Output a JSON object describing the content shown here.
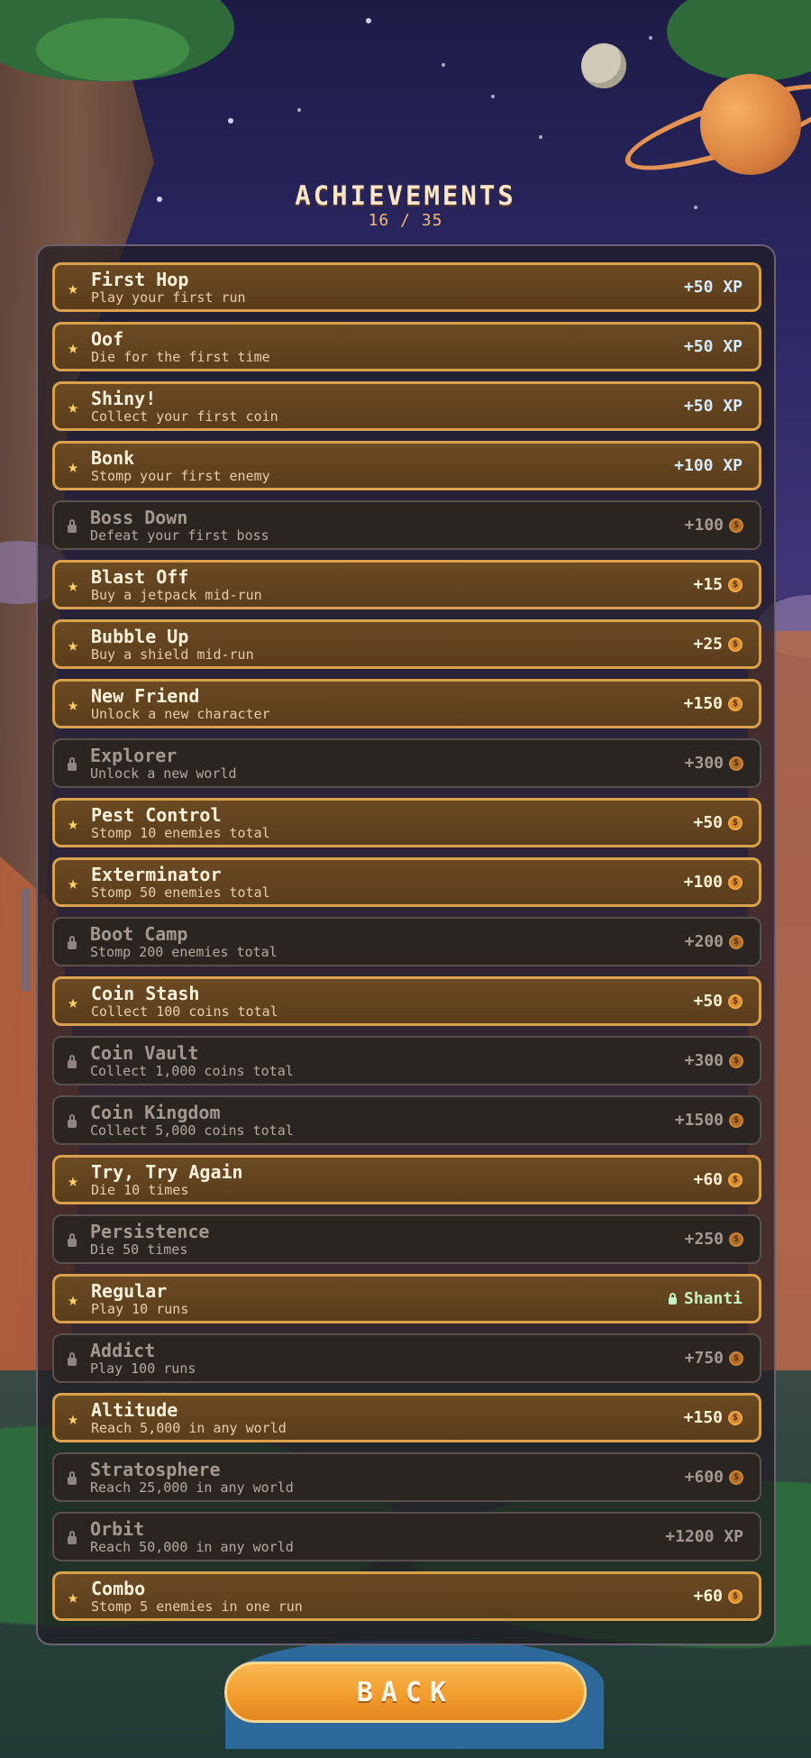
{
  "header": {
    "title": "ACHIEVEMENTS",
    "progress": "16 / 35"
  },
  "achievements": [
    {
      "name": "First Hop",
      "desc": "Play your first run",
      "reward": "+50 XP",
      "reward_type": "xp",
      "unlocked": true
    },
    {
      "name": "Oof",
      "desc": "Die for the first time",
      "reward": "+50 XP",
      "reward_type": "xp",
      "unlocked": true
    },
    {
      "name": "Shiny!",
      "desc": "Collect your first coin",
      "reward": "+50 XP",
      "reward_type": "xp",
      "unlocked": true
    },
    {
      "name": "Bonk",
      "desc": "Stomp your first enemy",
      "reward": "+100 XP",
      "reward_type": "xp",
      "unlocked": true
    },
    {
      "name": "Boss Down",
      "desc": "Defeat your first boss",
      "reward": "+100",
      "reward_type": "coin",
      "unlocked": false
    },
    {
      "name": "Blast Off",
      "desc": "Buy a jetpack mid-run",
      "reward": "+15",
      "reward_type": "coin",
      "unlocked": true
    },
    {
      "name": "Bubble Up",
      "desc": "Buy a shield mid-run",
      "reward": "+25",
      "reward_type": "coin",
      "unlocked": true
    },
    {
      "name": "New Friend",
      "desc": "Unlock a new character",
      "reward": "+150",
      "reward_type": "coin",
      "unlocked": true
    },
    {
      "name": "Explorer",
      "desc": "Unlock a new world",
      "reward": "+300",
      "reward_type": "coin",
      "unlocked": false
    },
    {
      "name": "Pest Control",
      "desc": "Stomp 10 enemies total",
      "reward": "+50",
      "reward_type": "coin",
      "unlocked": true
    },
    {
      "name": "Exterminator",
      "desc": "Stomp 50 enemies total",
      "reward": "+100",
      "reward_type": "coin",
      "unlocked": true
    },
    {
      "name": "Boot Camp",
      "desc": "Stomp 200 enemies total",
      "reward": "+200",
      "reward_type": "coin",
      "unlocked": false
    },
    {
      "name": "Coin Stash",
      "desc": "Collect 100 coins total",
      "reward": "+50",
      "reward_type": "coin",
      "unlocked": true
    },
    {
      "name": "Coin Vault",
      "desc": "Collect 1,000 coins total",
      "reward": "+300",
      "reward_type": "coin",
      "unlocked": false
    },
    {
      "name": "Coin Kingdom",
      "desc": "Collect 5,000 coins total",
      "reward": "+1500",
      "reward_type": "coin",
      "unlocked": false
    },
    {
      "name": "Try, Try Again",
      "desc": "Die 10 times",
      "reward": "+60",
      "reward_type": "coin",
      "unlocked": true
    },
    {
      "name": "Persistence",
      "desc": "Die 50 times",
      "reward": "+250",
      "reward_type": "coin",
      "unlocked": false
    },
    {
      "name": "Regular",
      "desc": "Play 10 runs",
      "reward": "Shanti",
      "reward_type": "character",
      "unlocked": true
    },
    {
      "name": "Addict",
      "desc": "Play 100 runs",
      "reward": "+750",
      "reward_type": "coin",
      "unlocked": false
    },
    {
      "name": "Altitude",
      "desc": "Reach 5,000 in any world",
      "reward": "+150",
      "reward_type": "coin",
      "unlocked": true
    },
    {
      "name": "Stratosphere",
      "desc": "Reach 25,000 in any world",
      "reward": "+600",
      "reward_type": "coin",
      "unlocked": false
    },
    {
      "name": "Orbit",
      "desc": "Reach 50,000 in any world",
      "reward": "+1200 XP",
      "reward_type": "xp",
      "unlocked": false
    },
    {
      "name": "Combo",
      "desc": "Stomp 5 enemies in one run",
      "reward": "+60",
      "reward_type": "coin",
      "unlocked": true
    }
  ],
  "icons": {
    "unlocked": "star-icon",
    "locked": "lock-icon",
    "coin": "coin-icon"
  },
  "colors": {
    "accent": "#f29a2c",
    "unlocked_border": "#d9a14b",
    "locked_bg": "#2b2522"
  },
  "footer": {
    "back_label": "BACK"
  }
}
